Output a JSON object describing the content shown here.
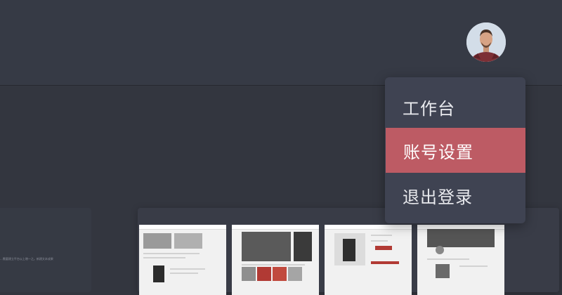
{
  "header": {
    "avatar": {
      "icon": "user-avatar-icon"
    }
  },
  "menu": {
    "items": [
      {
        "label": "工作台"
      },
      {
        "label": "账号设置",
        "active": true
      },
      {
        "label": "退出登录"
      }
    ],
    "active_color": "#bd5b64"
  },
  "background": {
    "left_card_note": "...需要建立平台以上增一之。新建文本成果"
  },
  "colors": {
    "page_bg": "#33363f",
    "header_bg": "#363a45",
    "menu_bg": "#3f4352"
  }
}
